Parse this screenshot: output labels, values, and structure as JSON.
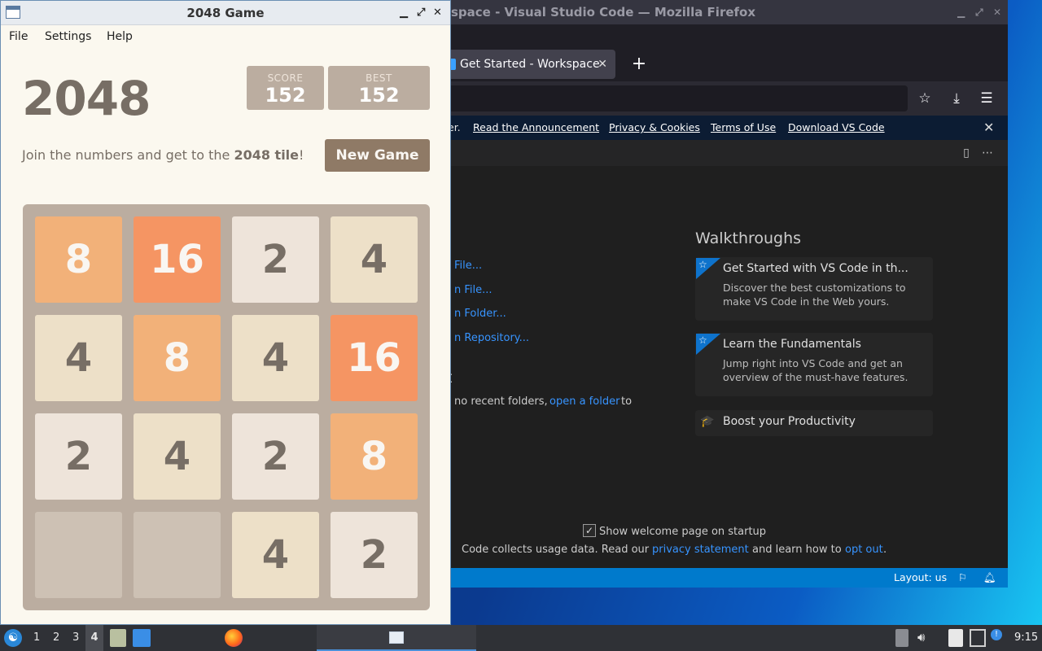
{
  "firefox": {
    "title": "space - Visual Studio Code — Mozilla Firefox",
    "tab_label": "Get Started - Workspace",
    "banner": {
      "partial": "er.",
      "links": [
        "Read the Announcement",
        "Privacy & Cookies",
        "Terms of Use",
        "Download VS Code"
      ]
    }
  },
  "vscode": {
    "start_links": [
      "File...",
      "n File...",
      "n Folder...",
      "n Repository..."
    ],
    "recent_heading": "t",
    "recent_text": "no recent folders,",
    "recent_link": "open a folder",
    "recent_to": "to",
    "walkthroughs_heading": "Walkthroughs",
    "walkthroughs": [
      {
        "title": "Get Started with VS Code in th...",
        "desc": "Discover the best customizations to make VS Code in the Web yours."
      },
      {
        "title": "Learn the Fundamentals",
        "desc": "Jump right into VS Code and get an overview of the must-have features."
      },
      {
        "title": "Boost your Productivity",
        "desc": ""
      }
    ],
    "show_welcome": "Show welcome page on startup",
    "usage_prefix": "Code collects usage data. Read our",
    "privacy_link": "privacy statement",
    "usage_mid": "and learn how to",
    "opt_out_link": "opt out",
    "usage_end": ".",
    "status_layout": "Layout: us"
  },
  "game": {
    "window_title": "2048 Game",
    "menu": [
      "File",
      "Settings",
      "Help"
    ],
    "heading": "2048",
    "score_label": "SCORE",
    "score": "152",
    "best_label": "BEST",
    "best": "152",
    "intro_prefix": "Join the numbers and get to the",
    "intro_bold": "2048 tile",
    "intro_suffix": "!",
    "new_game": "New Game",
    "board": [
      [
        "8",
        "16",
        "2",
        "4"
      ],
      [
        "4",
        "8",
        "4",
        "16"
      ],
      [
        "2",
        "4",
        "2",
        "8"
      ],
      [
        "",
        "",
        "4",
        "2"
      ]
    ],
    "tile_colors": {
      "": {
        "bg": "#cdc1b4",
        "fg": "#776e65"
      },
      "2": {
        "bg": "#eee4da",
        "fg": "#776e65"
      },
      "4": {
        "bg": "#ede0c8",
        "fg": "#776e65"
      },
      "8": {
        "bg": "#f2b179",
        "fg": "#f9f6f2"
      },
      "16": {
        "bg": "#f59563",
        "fg": "#f9f6f2"
      }
    }
  },
  "taskbar": {
    "workspaces": [
      "1",
      "2",
      "3",
      "4"
    ],
    "clock": "9:15"
  }
}
